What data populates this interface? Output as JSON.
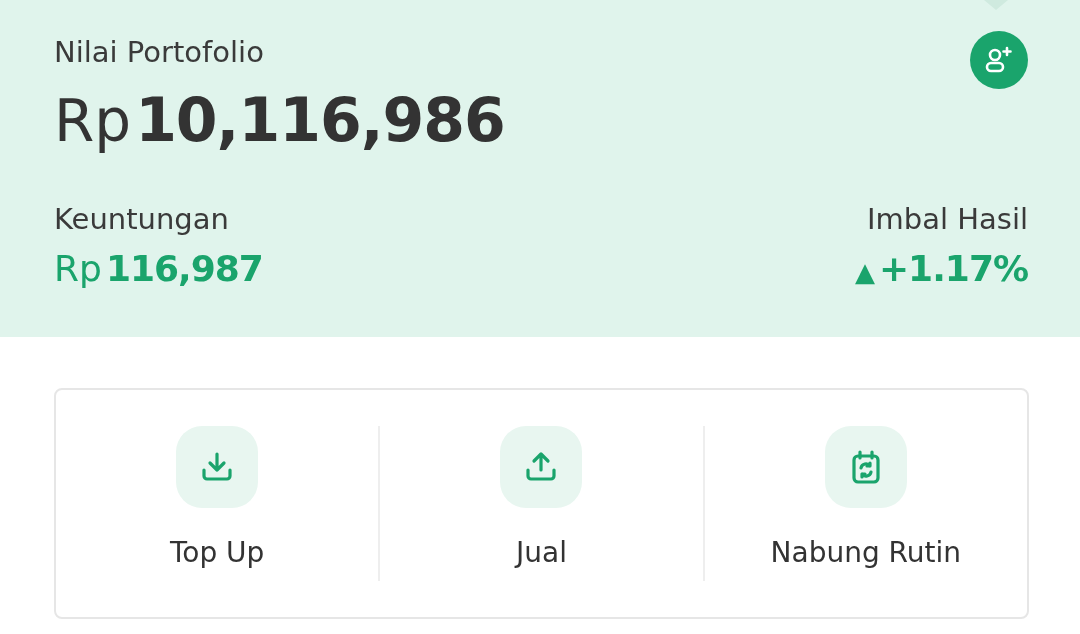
{
  "portfolio": {
    "label": "Nilai Portofolio",
    "currency": "Rp",
    "amount": "10,116,986"
  },
  "profit": {
    "label": "Keuntungan",
    "currency": "Rp",
    "amount": "116,987"
  },
  "return": {
    "label": "Imbal Hasil",
    "arrow": "▲",
    "value": "+1.17%"
  },
  "actions": [
    {
      "kind": "download",
      "label": "Top Up"
    },
    {
      "kind": "upload",
      "label": "Jual"
    },
    {
      "kind": "calendar",
      "label": "Nabung Rutin"
    }
  ]
}
